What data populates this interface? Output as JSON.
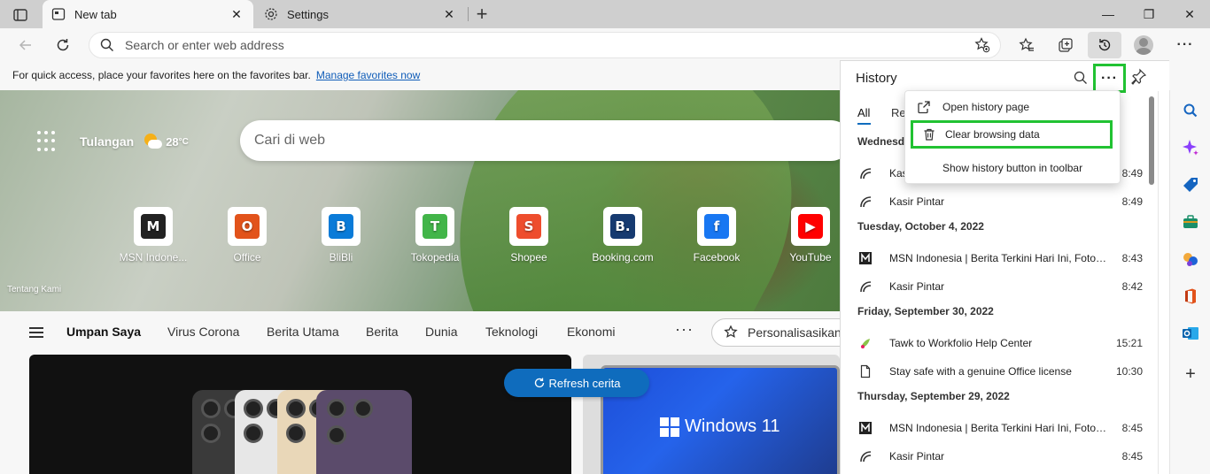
{
  "tabs": [
    {
      "title": "New tab",
      "close": "✕"
    },
    {
      "title": "Settings",
      "close": "✕"
    }
  ],
  "new_tab_symbol": "+",
  "window_controls": {
    "minimize": "—",
    "restore": "❐",
    "close": "✕"
  },
  "address_bar": {
    "placeholder": "Search or enter web address"
  },
  "favorites_bar": {
    "text": "For quick access, place your favorites here on the favorites bar.",
    "link": "Manage favorites now"
  },
  "newtab": {
    "location": "Tulangan",
    "temperature": "28",
    "temp_unit": "°C",
    "search_placeholder": "Cari di web",
    "tiles": [
      {
        "label": "MSN Indone...",
        "icon": "msn-icon",
        "color": "#222222",
        "glyph": "M"
      },
      {
        "label": "Office",
        "icon": "office-icon",
        "color": "#e2531b",
        "glyph": "O"
      },
      {
        "label": "BliBli",
        "icon": "blibli-icon",
        "color": "#0a7bd8",
        "glyph": "B"
      },
      {
        "label": "Tokopedia",
        "icon": "tokopedia-icon",
        "color": "#42b549",
        "glyph": "T"
      },
      {
        "label": "Shopee",
        "icon": "shopee-icon",
        "color": "#ee4d2d",
        "glyph": "S"
      },
      {
        "label": "Booking.com",
        "icon": "booking-icon",
        "color": "#163a70",
        "glyph": "B."
      },
      {
        "label": "Facebook",
        "icon": "facebook-icon",
        "color": "#1877f2",
        "glyph": "f"
      },
      {
        "label": "YouTube",
        "icon": "youtube-icon",
        "color": "#ff0000",
        "glyph": "▶"
      }
    ],
    "tentang": "Tentang Kami",
    "feed_nav": [
      "Umpan Saya",
      "Virus Corona",
      "Berita Utama",
      "Berita",
      "Dunia",
      "Teknologi",
      "Ekonomi"
    ],
    "more": "···",
    "personalize": "Personalisasikan",
    "refresh": "Refresh cerita",
    "windows_card_text": "Windows 11"
  },
  "history": {
    "title": "History",
    "more": "···",
    "tab_all": "All",
    "tab_recent": "Rec",
    "groups": [
      {
        "date": "Wednesda",
        "items": [
          {
            "title": "Kas",
            "time": "8:49",
            "icon": "kasir-icon"
          },
          {
            "title": "Kasir Pintar",
            "time": "8:49",
            "icon": "kasir-icon"
          }
        ]
      },
      {
        "date": "Tuesday, October 4, 2022",
        "items": [
          {
            "title": "MSN Indonesia | Berita Terkini Hari Ini, Foto, Video",
            "time": "8:43",
            "icon": "msn-icon"
          },
          {
            "title": "Kasir Pintar",
            "time": "8:42",
            "icon": "kasir-icon"
          }
        ]
      },
      {
        "date": "Friday, September 30, 2022",
        "items": [
          {
            "title": "Tawk to Workfolio Help Center",
            "time": "15:21",
            "icon": "tawk-icon"
          },
          {
            "title": "Stay safe with a genuine Office license",
            "time": "10:30",
            "icon": "document-icon"
          }
        ]
      },
      {
        "date": "Thursday, September 29, 2022",
        "items": [
          {
            "title": "MSN Indonesia | Berita Terkini Hari Ini, Foto, Video",
            "time": "8:45",
            "icon": "msn-icon"
          },
          {
            "title": "Kasir Pintar",
            "time": "8:45",
            "icon": "kasir-icon"
          }
        ]
      }
    ]
  },
  "history_menu": {
    "open_history_page": "Open history page",
    "clear_browsing_data": "Clear browsing data",
    "show_history_button": "Show history button in toolbar"
  },
  "colors": {
    "highlight": "#21c232",
    "accent": "#0f6cbd"
  }
}
